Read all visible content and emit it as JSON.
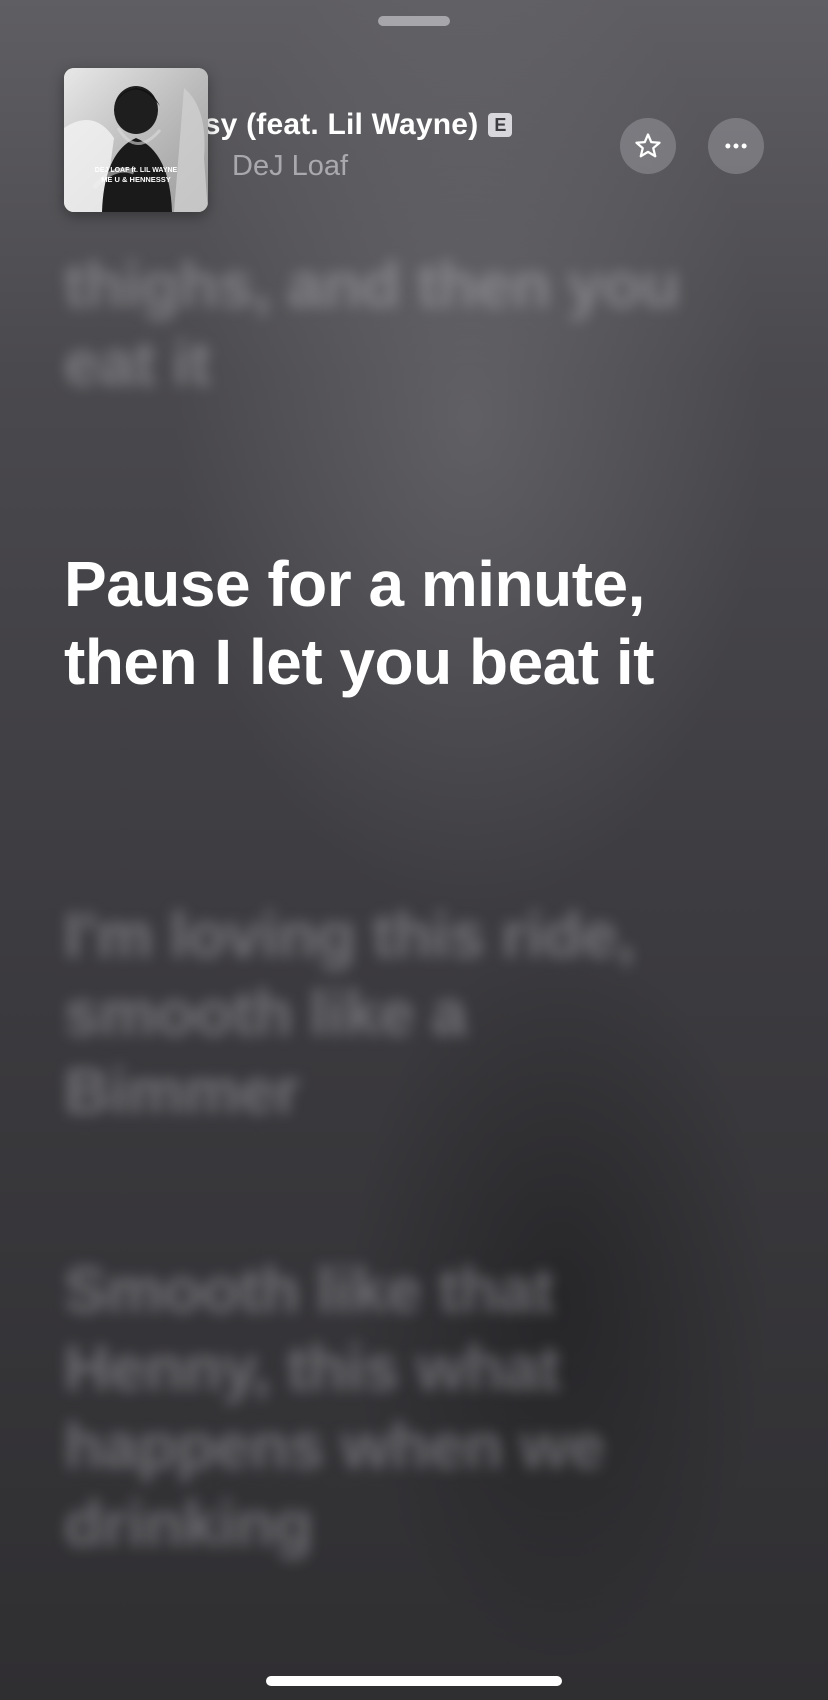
{
  "now_playing": {
    "title": "Me U & Hennessy (feat. Lil Wayne)",
    "title_visible": "essy (feat. Lil Wayne)",
    "explicit_badge": "E",
    "artist": "DeJ Loaf",
    "artwork": {
      "artist_text": "DEJ LOAF ft. LIL WAYNE",
      "album_text": "ME U & HENNESSY"
    },
    "favorite_icon": "star-icon",
    "more_icon": "ellipsis-icon"
  },
  "lyrics": {
    "previous": "thighs, and then you eat it",
    "current": "Pause for a minute, then I let you beat it",
    "next_1": "I'm loving this ride, smooth like a Bimmer",
    "next_2": "Smooth like that Henny, this what happens when we drinking"
  },
  "colors": {
    "background_top": "#5f5e62",
    "background_bottom": "#2f2e31",
    "active_lyric": "#ffffff",
    "inactive_lyric": "rgba(205,205,210,0.38)"
  }
}
